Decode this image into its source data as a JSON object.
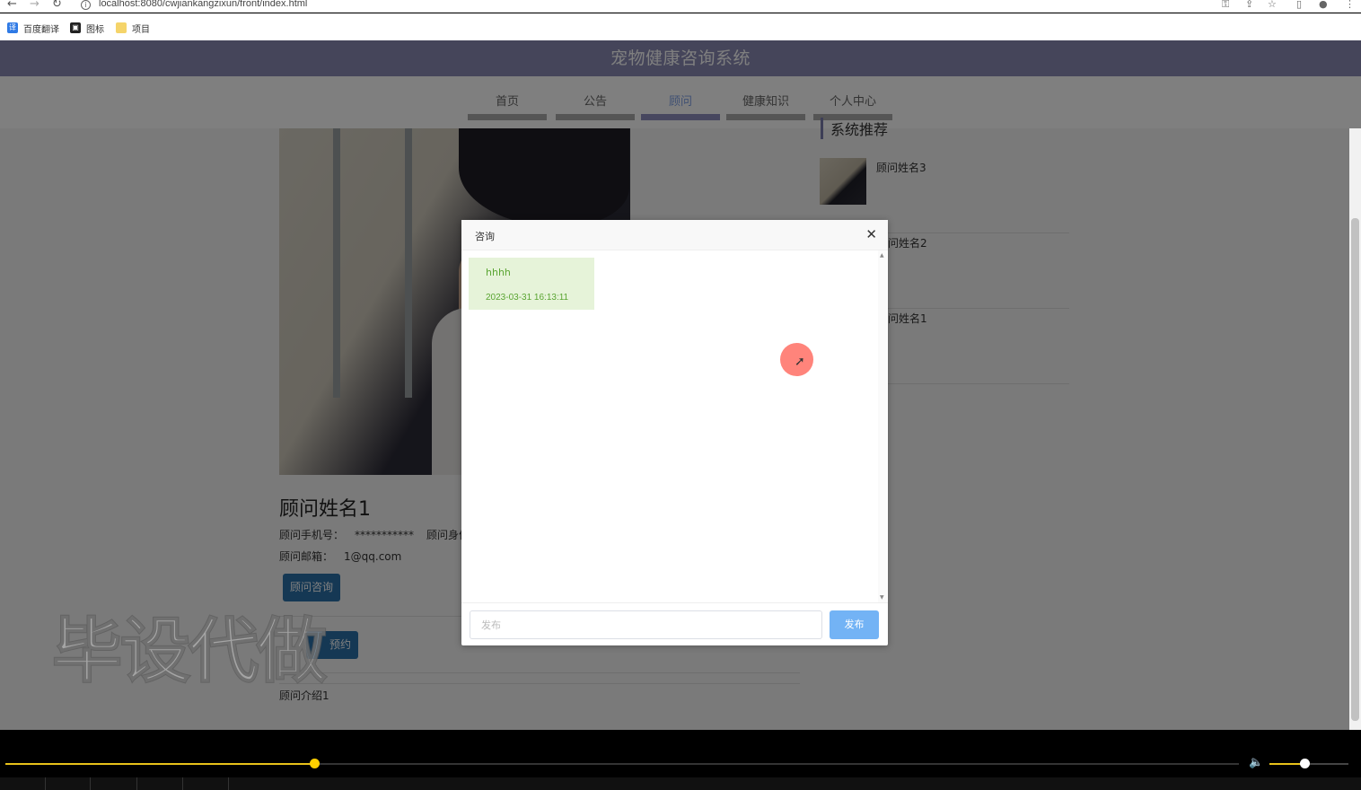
{
  "browser": {
    "url": "localhost:8080/cwjiankangzixun/front/index.html",
    "bookmarks": [
      {
        "label": "百度翻译",
        "icon": "translate-icon",
        "color": "#2f7ae5"
      },
      {
        "label": "图标",
        "icon": "image-icon",
        "color": "#222222"
      },
      {
        "label": "项目",
        "icon": "folder-icon",
        "color": "#f5c842"
      }
    ]
  },
  "site": {
    "title": "宠物健康咨询系统",
    "nav": [
      "首页",
      "公告",
      "顾问",
      "健康知识",
      "个人中心"
    ],
    "active_nav": "顾问"
  },
  "advisor": {
    "name": "顾问姓名1",
    "phone_label": "顾问手机号：",
    "phone_value": "***********",
    "id_label": "顾问身份",
    "email_label": "顾问邮箱：",
    "email_value": "1@qq.com",
    "consult_button": "顾问咨询",
    "booking_button": "预约",
    "intro": "顾问介绍1"
  },
  "sidebar": {
    "title": "系统推荐",
    "items": [
      {
        "name": "顾问姓名3"
      },
      {
        "name": "问姓名2"
      },
      {
        "name": "问姓名1"
      }
    ]
  },
  "dialog": {
    "title": "咨询",
    "close_icon": "close-icon",
    "messages": [
      {
        "text": "hhhh",
        "time": "2023-03-31 16:13:11"
      }
    ],
    "input_placeholder": "发布",
    "input_value": "",
    "send_button": "发布"
  },
  "watermark": "毕设代做",
  "player": {
    "progress": 0.25,
    "volume": 0.44,
    "accent_color": "#e8c21a"
  },
  "colors": {
    "header": "#8a8bb5",
    "active_nav": "#7fa0e6",
    "primary_button": "#2a70a8",
    "send_button": "#73b3f5",
    "bubble": "#e6f3d9",
    "bubble_text": "#5aa532"
  }
}
